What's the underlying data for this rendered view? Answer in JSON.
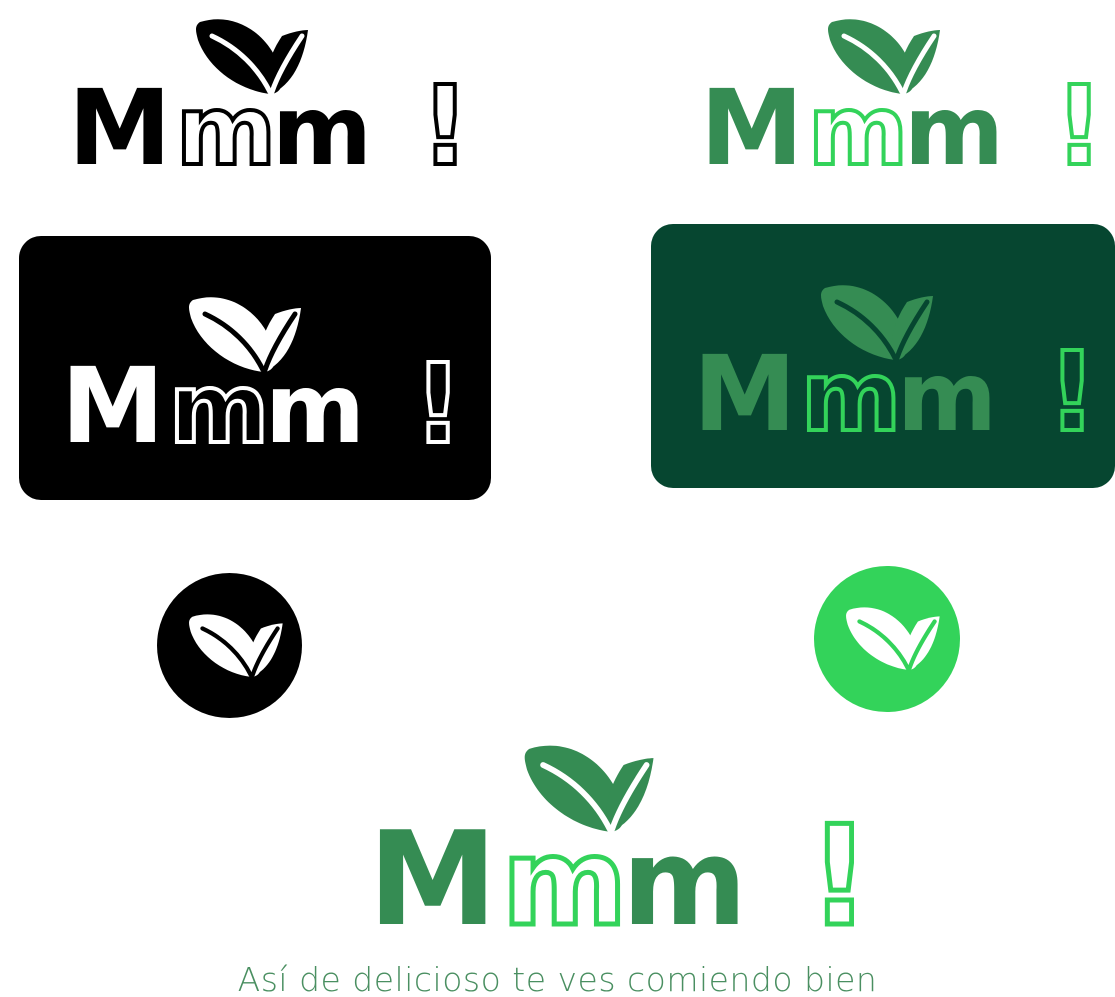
{
  "brand": {
    "letters": [
      "M",
      "m",
      "m",
      "m",
      "!"
    ],
    "tagline": "Así de delicioso te ves comiendo bien"
  },
  "colors": {
    "black": "#000000",
    "white": "#ffffff",
    "brand_green": "#358c53",
    "bright_green": "#33d35a",
    "dark_green_bg": "#064630",
    "tagline_green": "#4a8f61"
  },
  "icons": [
    "leaf-pair-icon"
  ],
  "variants": [
    {
      "name": "black-on-white"
    },
    {
      "name": "green-on-white"
    },
    {
      "name": "white-on-black"
    },
    {
      "name": "green-on-dark-green"
    },
    {
      "name": "black-badge"
    },
    {
      "name": "green-badge"
    },
    {
      "name": "primary-with-tagline"
    }
  ]
}
